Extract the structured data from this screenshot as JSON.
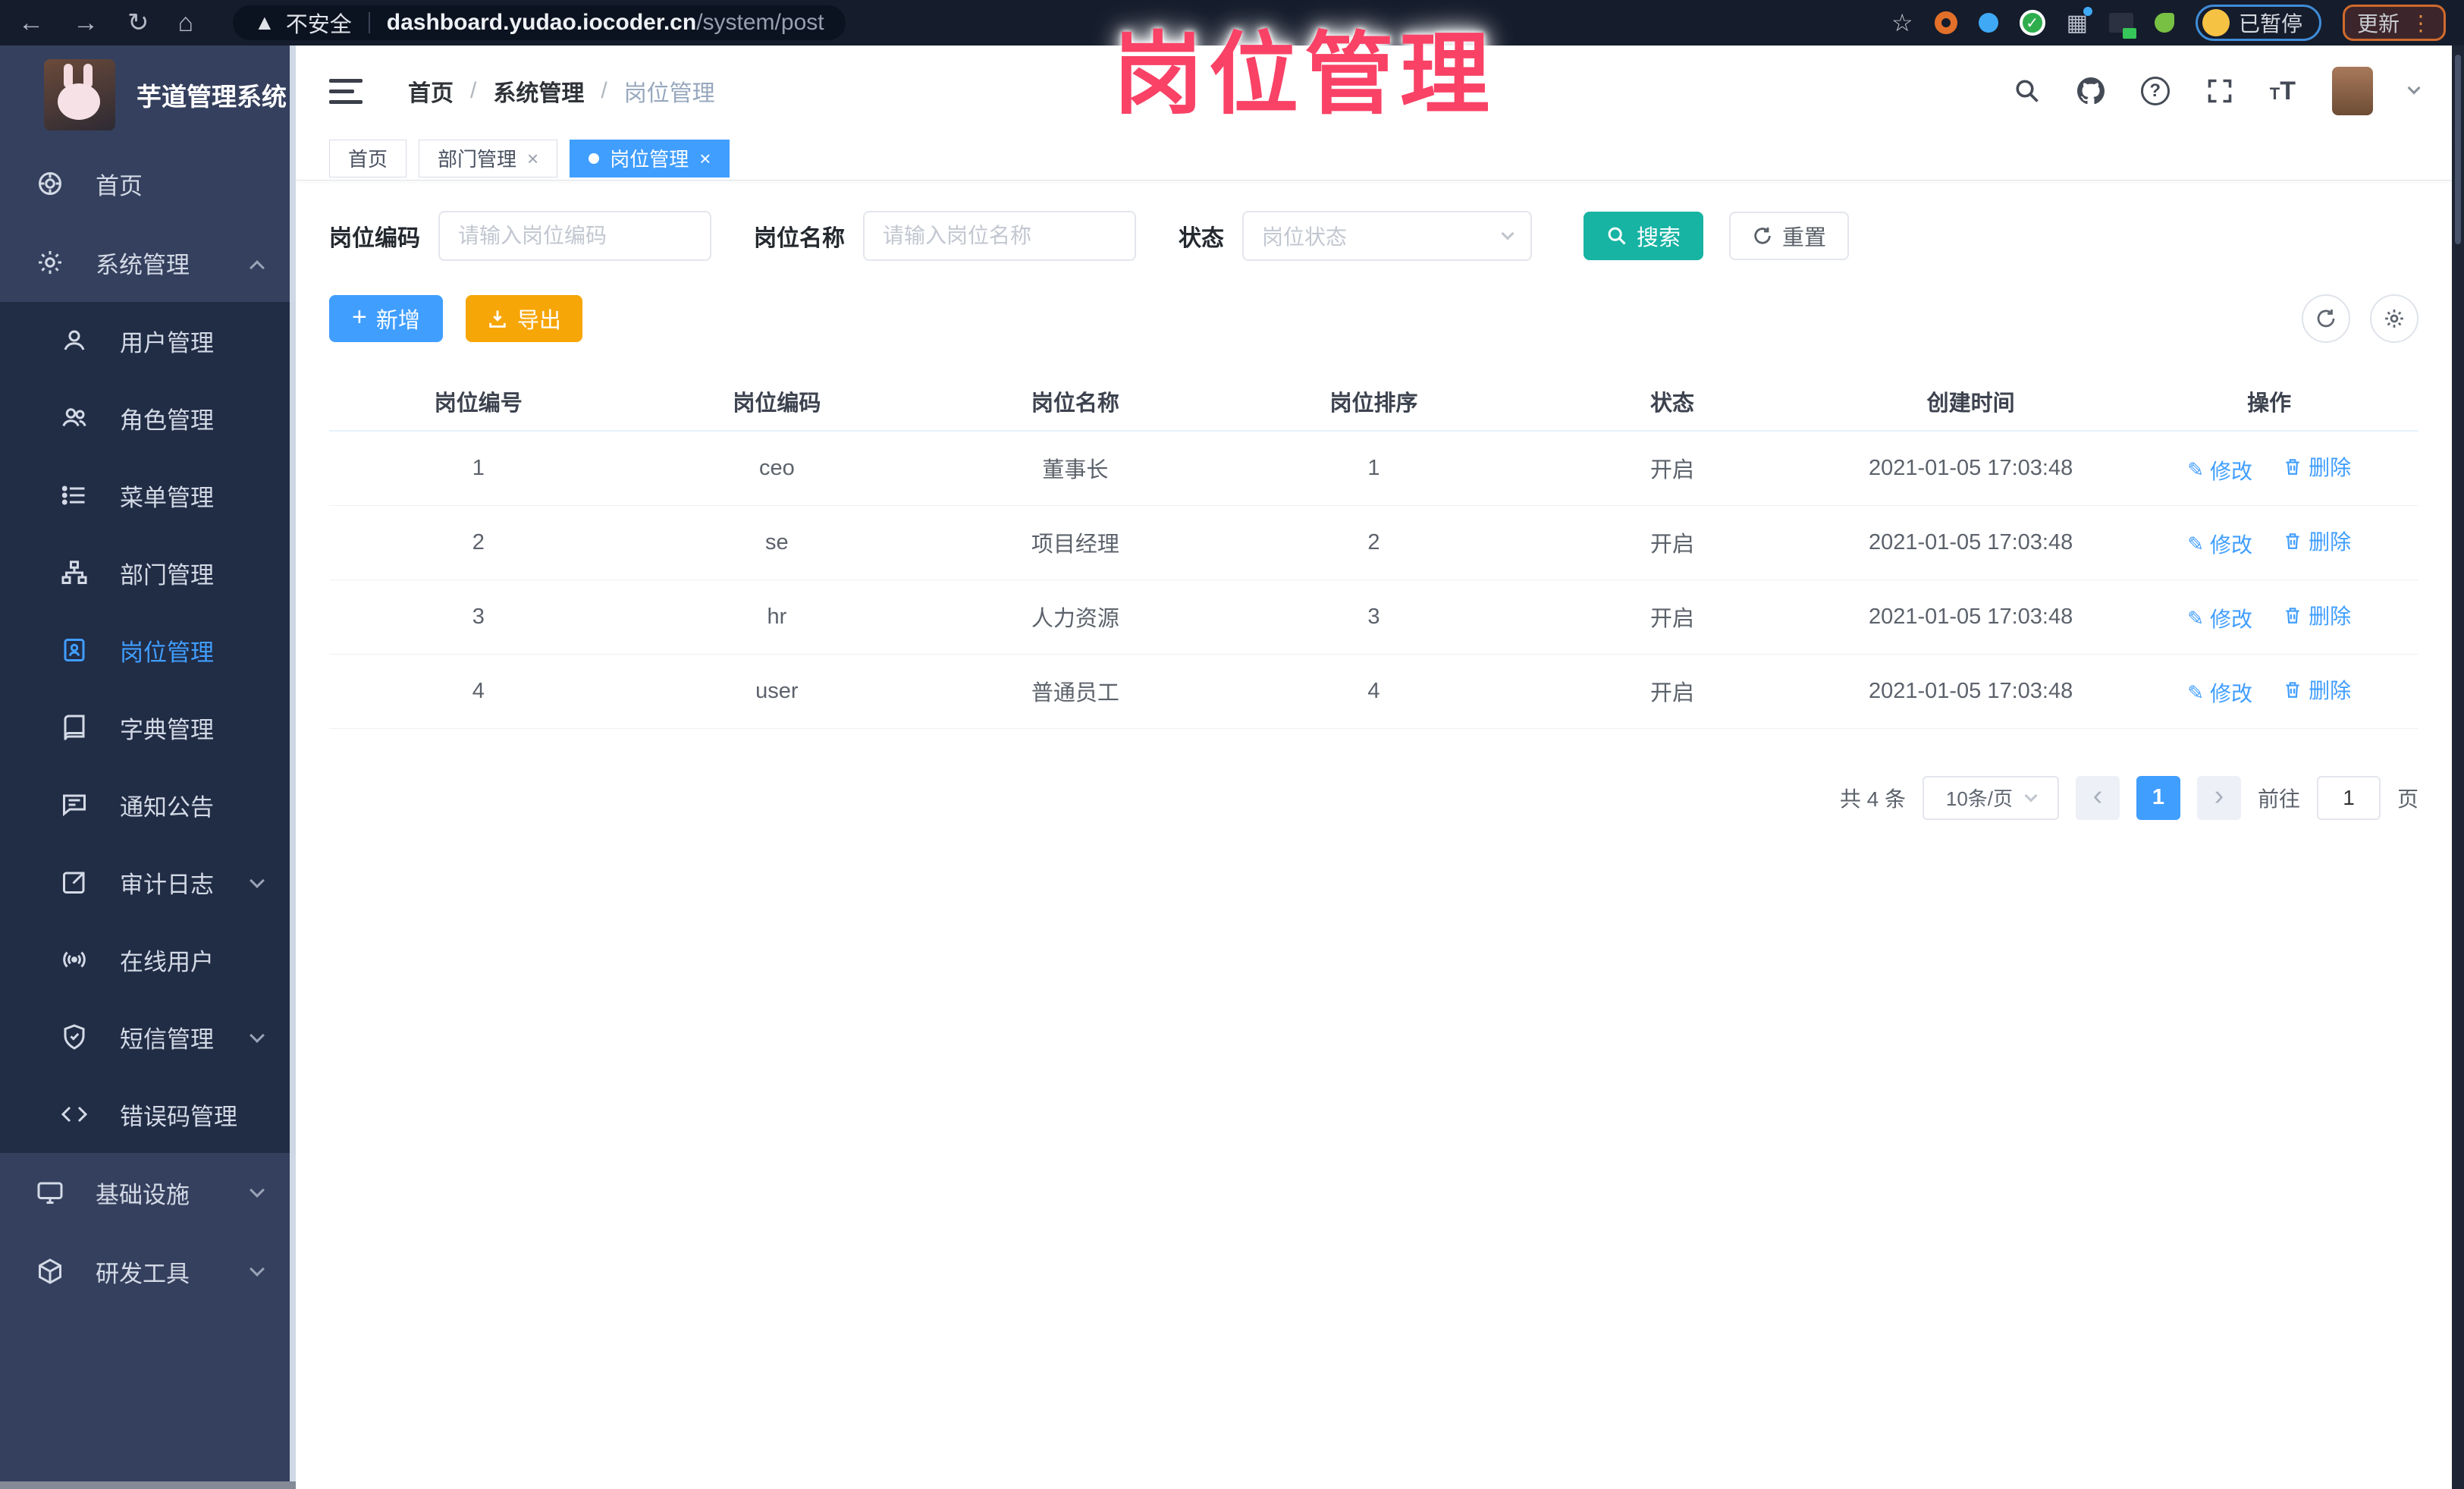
{
  "colors": {
    "accent": "#409eff",
    "search_button": "#17b3a3",
    "export_button": "#f7a608",
    "overlay_title": "#f94266",
    "sidebar_bg": "#35405e",
    "submenu_bg": "#212c45",
    "topbar_bg": "#151c2b"
  },
  "overlay": {
    "title": "岗位管理"
  },
  "browser": {
    "security_label": "不安全",
    "url_domain": "dashboard.yudao.iocoder.cn",
    "url_path": "/system/post",
    "paused_label": "已暂停",
    "update_label": "更新"
  },
  "sidebar": {
    "app_title": "芋道管理系统",
    "items": [
      {
        "label": "首页"
      },
      {
        "label": "系统管理"
      },
      {
        "label": "用户管理"
      },
      {
        "label": "角色管理"
      },
      {
        "label": "菜单管理"
      },
      {
        "label": "部门管理"
      },
      {
        "label": "岗位管理"
      },
      {
        "label": "字典管理"
      },
      {
        "label": "通知公告"
      },
      {
        "label": "审计日志"
      },
      {
        "label": "在线用户"
      },
      {
        "label": "短信管理"
      },
      {
        "label": "错误码管理"
      },
      {
        "label": "基础设施"
      },
      {
        "label": "研发工具"
      }
    ]
  },
  "header": {
    "breadcrumb": [
      "首页",
      "系统管理",
      "岗位管理"
    ],
    "separator": "/"
  },
  "tabs": [
    {
      "label": "首页"
    },
    {
      "label": "部门管理"
    },
    {
      "label": "岗位管理"
    }
  ],
  "search": {
    "code_label": "岗位编码",
    "code_placeholder": "请输入岗位编码",
    "name_label": "岗位名称",
    "name_placeholder": "请输入岗位名称",
    "status_label": "状态",
    "status_placeholder": "岗位状态",
    "search_label": "搜索",
    "reset_label": "重置"
  },
  "toolbar": {
    "add_label": "新增",
    "export_label": "导出"
  },
  "table": {
    "headers": [
      "岗位编号",
      "岗位编码",
      "岗位名称",
      "岗位排序",
      "状态",
      "创建时间",
      "操作"
    ],
    "rows": [
      {
        "id": "1",
        "code": "ceo",
        "name": "董事长",
        "sort": "1",
        "status": "开启",
        "created": "2021-01-05 17:03:48"
      },
      {
        "id": "2",
        "code": "se",
        "name": "项目经理",
        "sort": "2",
        "status": "开启",
        "created": "2021-01-05 17:03:48"
      },
      {
        "id": "3",
        "code": "hr",
        "name": "人力资源",
        "sort": "3",
        "status": "开启",
        "created": "2021-01-05 17:03:48"
      },
      {
        "id": "4",
        "code": "user",
        "name": "普通员工",
        "sort": "4",
        "status": "开启",
        "created": "2021-01-05 17:03:48"
      }
    ],
    "actions": {
      "edit": "修改",
      "delete": "删除"
    }
  },
  "pagination": {
    "total": "共 4 条",
    "page_size": "10条/页",
    "current": "1",
    "goto_label": "前往",
    "goto_value": "1",
    "unit_label": "页"
  }
}
